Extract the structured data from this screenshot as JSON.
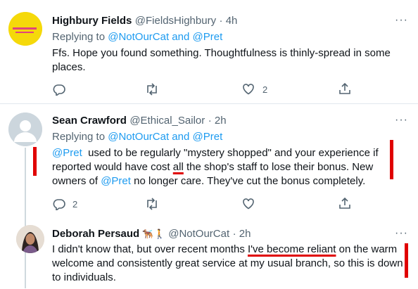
{
  "tweets": [
    {
      "name": "Highbury Fields",
      "handle": "@FieldsHighbury",
      "time": "· 4h",
      "replying_prefix": "Replying to ",
      "replying_to": "@NotOurCat and @Pret",
      "lines": [
        "Ffs. Hope you found something. Thoughtfulness is thinly-spread in some",
        "places."
      ],
      "like_count": "2",
      "avatar_color": "#f5d90a"
    },
    {
      "name": "Sean Crawford",
      "handle": "@Ethical_Sailor",
      "time": "· 2h",
      "replying_prefix": "Replying to ",
      "replying_to": "@NotOurCat and @Pret",
      "l1_mention": "@Pret",
      "l1_rest": "  used to be regularly \"mystery shopped\" and your experience if",
      "l2_pre": "reported would have cost ",
      "l2_under": "all",
      "l2_post": " the shop's staff to lose their bonus. New",
      "l3_pre": "owners of ",
      "l3_mention": "@Pret",
      "l3_post": " no longer care. They've cut the bonus completely.",
      "reply_count": "2"
    },
    {
      "name": "Deborah Persaud",
      "emoji": "🐕‍🦺🚶",
      "handle": "@NotOurCat",
      "time": "· 2h",
      "l1_pre": "I didn't know that, but over recent months ",
      "l1_under": "I've become reliant",
      "l1_post": " on the warm",
      "l2": "welcome and consistently great service at my usual branch, so this is down",
      "l3": "to individuals."
    }
  ],
  "more_label": "···",
  "colors": {
    "link": "#1d9bf0",
    "annotation": "#e00000",
    "muted": "#536471"
  },
  "icons": [
    "reply-icon",
    "retweet-icon",
    "like-icon",
    "share-icon"
  ]
}
